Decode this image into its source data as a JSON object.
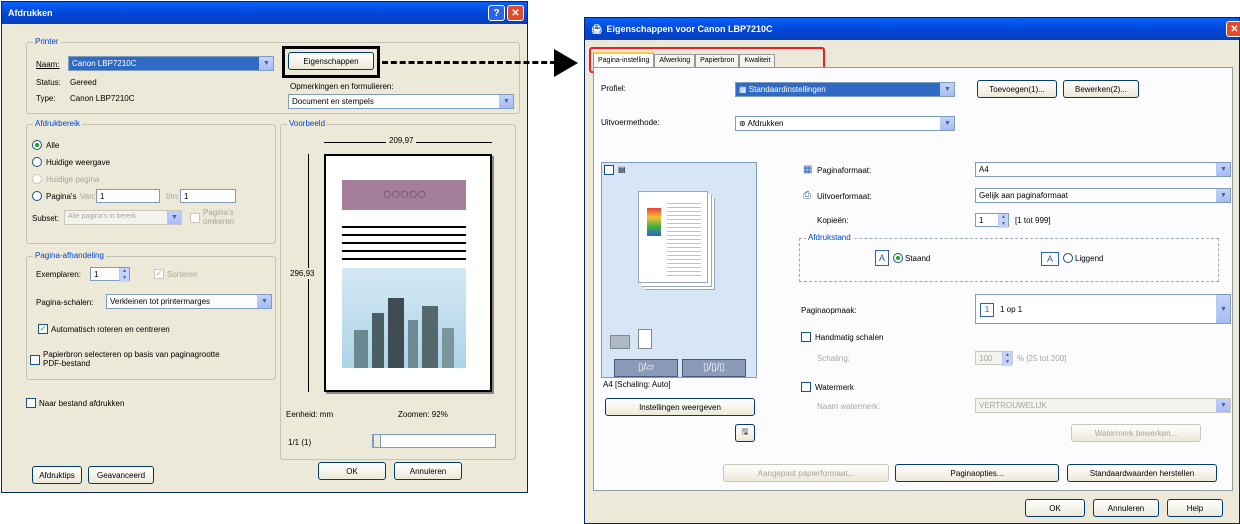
{
  "print_dialog": {
    "title": "Afdrukken",
    "printer": {
      "group": "Printer",
      "name_label": "Naam:",
      "name_value": "Canon LBP7210C",
      "status_label": "Status:",
      "status_value": "Gereed",
      "type_label": "Type:",
      "type_value": "Canon LBP7210C",
      "properties_button": "Eigenschappen",
      "comments_label": "Opmerkingen en formulieren:",
      "comments_value": "Document en stempels"
    },
    "range": {
      "group": "Afdrukbereik",
      "all": "Alle",
      "current_view": "Huidige weergave",
      "current_page": "Huidige pagina",
      "pages": "Pagina's",
      "from_label": "Van:",
      "from_value": "1",
      "to_label": "t/m:",
      "to_value": "1",
      "subset_label": "Subset:",
      "subset_value": "Alle pagina's in bereik",
      "reverse_label": "Pagina's omkeren"
    },
    "handling": {
      "group": "Pagina-afhandeling",
      "copies_label": "Exemplaren:",
      "copies_value": "1",
      "collate_label": "Sorteren",
      "scaling_label": "Pagina-schalen:",
      "scaling_value": "Verkleinen tot printermarges",
      "autorotate_label": "Automatisch roteren en centreren",
      "paper_source_label_1": "Papierbron selecteren op basis van paginagrootte",
      "paper_source_label_2": "PDF-bestand"
    },
    "print_to_file": "Naar bestand afdrukken",
    "preview": {
      "group": "Voorbeeld",
      "width": "209,97",
      "height": "296,93",
      "unit_label": "Eenheid: mm",
      "zoom_label": "Zoomen: 92%",
      "page_counter": "1/1 (1)"
    },
    "buttons": {
      "tips": "Afdruktips",
      "advanced": "Geavanceerd",
      "ok": "OK",
      "cancel": "Annuleren"
    }
  },
  "props_dialog": {
    "title": "Eigenschappen voor Canon LBP7210C",
    "tabs": [
      "Pagina-instelling",
      "Afwerking",
      "Papierbron",
      "Kwaliteit"
    ],
    "profile_label": "Profiel:",
    "profile_value": "Standaardinstellingen",
    "add_button": "Toevoegen(1)...",
    "edit_button": "Bewerken(2)...",
    "output_label": "Uitvoermethode:",
    "output_value": "Afdrukken",
    "page_size_label": "Paginaformaat:",
    "page_size_value": "A4",
    "output_size_label": "Uitvoerformaat:",
    "output_size_value": "Gelijk aan paginaformaat",
    "copies_label": "Kopieën:",
    "copies_value": "1",
    "copies_range": "[1 tot 999]",
    "orientation_group": "Afdrukstand",
    "portrait": "Staand",
    "landscape": "Liggend",
    "layout_label": "Paginaopmaak:",
    "layout_value": "1 op 1",
    "manual_scaling": "Handmatig schalen",
    "scaling_label": "Schaling:",
    "scaling_value": "100",
    "scaling_range": "% [25 tot 200]",
    "watermark_label": "Watermerk",
    "watermark_name_label": "Naam watermerk:",
    "watermark_value": "VERTROUWELIJK",
    "watermark_edit": "Watermerk bewerken...",
    "preview_caption": "A4 [Schaling: Auto]",
    "view_settings": "Instellingen weergeven",
    "custom_paper": "Aangepast papierformaat...",
    "page_options": "Paginaopties...",
    "restore_defaults": "Standaardwaarden herstellen",
    "ok": "OK",
    "cancel": "Annuleren",
    "help": "Help"
  }
}
